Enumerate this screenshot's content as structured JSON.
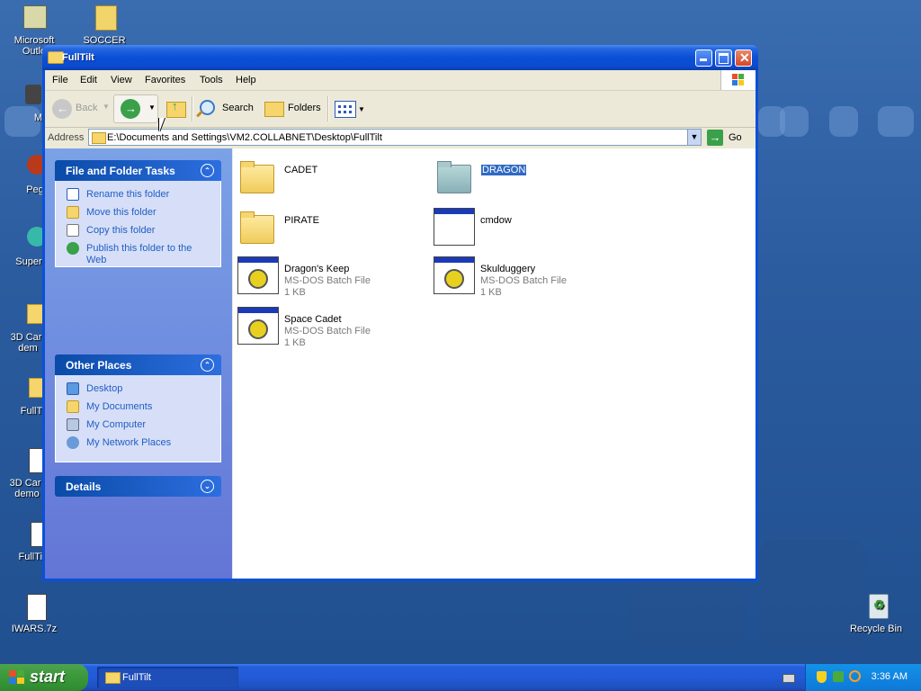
{
  "desktop": {
    "icons": [
      {
        "label1": "Microsoft",
        "label2": "Outlo"
      },
      {
        "label1": "SOCCER",
        "label2": ""
      },
      {
        "label1": "MyPa",
        "label2": ""
      },
      {
        "label1": "Peg",
        "label2": ""
      },
      {
        "label1": "Supern",
        "label2": ""
      },
      {
        "label1": "3D Car",
        "label2": "dem"
      },
      {
        "label1": "FullT",
        "label2": ""
      },
      {
        "label1": "3D Car",
        "label2": "demo"
      },
      {
        "label1": "FullTil",
        "label2": ""
      },
      {
        "label1": "IWARS.7z",
        "label2": ""
      },
      {
        "label1": "Recycle Bin",
        "label2": ""
      }
    ]
  },
  "window": {
    "title": "FullTilt",
    "menu": [
      "File",
      "Edit",
      "View",
      "Favorites",
      "Tools",
      "Help"
    ],
    "toolbar": {
      "back": "Back",
      "search": "Search",
      "folders": "Folders"
    },
    "address": {
      "label": "Address",
      "value": "E:\\Documents and Settings\\VM2.COLLABNET\\Desktop\\FullTilt",
      "go": "Go"
    },
    "tasks_panel": {
      "title": "File and Folder Tasks",
      "items": [
        "Rename this folder",
        "Move this folder",
        "Copy this folder",
        "Publish this folder to the",
        "Web"
      ]
    },
    "places_panel": {
      "title": "Other Places",
      "items": [
        "Desktop",
        "My Documents",
        "My Computer",
        "My Network Places"
      ]
    },
    "details_panel": {
      "title": "Details"
    },
    "files": [
      {
        "name": "CADET",
        "type": "",
        "size": "",
        "icon": "folder-icon"
      },
      {
        "name": "DRAGON",
        "type": "",
        "size": "",
        "icon": "folder-icon"
      },
      {
        "name": "PIRATE",
        "type": "",
        "size": "",
        "icon": "folder-icon"
      },
      {
        "name": "cmdow",
        "type": "",
        "size": "",
        "icon": "application-icon"
      },
      {
        "name": "Dragon's Keep",
        "type": "MS-DOS Batch File",
        "size": "1 KB",
        "icon": "batch-file-icon"
      },
      {
        "name": "Skulduggery",
        "type": "MS-DOS Batch File",
        "size": "1 KB",
        "icon": "batch-file-icon"
      },
      {
        "name": "Space Cadet",
        "type": "MS-DOS Batch File",
        "size": "1 KB",
        "icon": "batch-file-icon"
      }
    ]
  },
  "taskbar": {
    "start": "start",
    "task": "FullTilt",
    "clock": "3:36 AM"
  }
}
